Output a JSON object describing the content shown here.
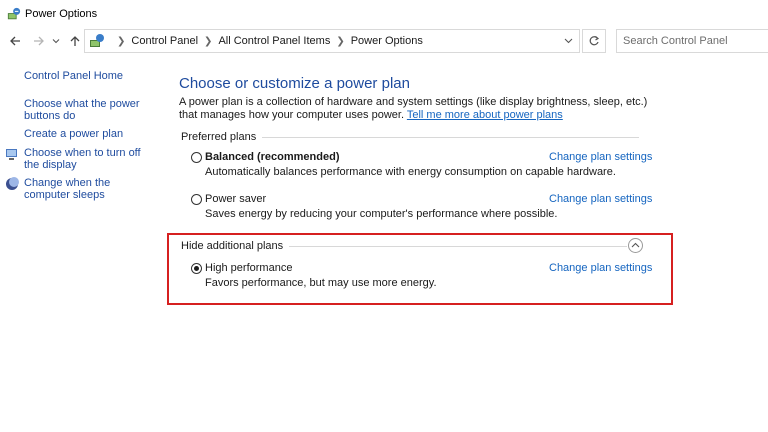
{
  "window": {
    "title": "Power Options"
  },
  "address": {
    "breadcrumbs": [
      "Control Panel",
      "All Control Panel Items",
      "Power Options"
    ],
    "search_placeholder": "Search Control Panel"
  },
  "sidebar": {
    "home": "Control Panel Home",
    "links": [
      "Choose what the power buttons do",
      "Create a power plan",
      "Choose when to turn off the display",
      "Change when the computer sleeps"
    ]
  },
  "main": {
    "title": "Choose or customize a power plan",
    "description": "A power plan is a collection of hardware and system settings (like display brightness, sleep, etc.) that manages how your computer uses power.",
    "description_link": "Tell me more about power plans",
    "preferred_label": "Preferred plans",
    "hide_label": "Hide additional plans",
    "change_link": "Change plan settings",
    "plans": [
      {
        "name": "Balanced (recommended)",
        "desc": "Automatically balances performance with energy consumption on capable hardware.",
        "selected": false
      },
      {
        "name": "Power saver",
        "desc": "Saves energy by reducing your computer's performance where possible.",
        "selected": false
      },
      {
        "name": "High performance",
        "desc": "Favors performance, but may use more energy.",
        "selected": true
      }
    ]
  },
  "colors": {
    "link": "#1565c0",
    "title": "#1e4b9e",
    "highlight": "#d62020"
  }
}
